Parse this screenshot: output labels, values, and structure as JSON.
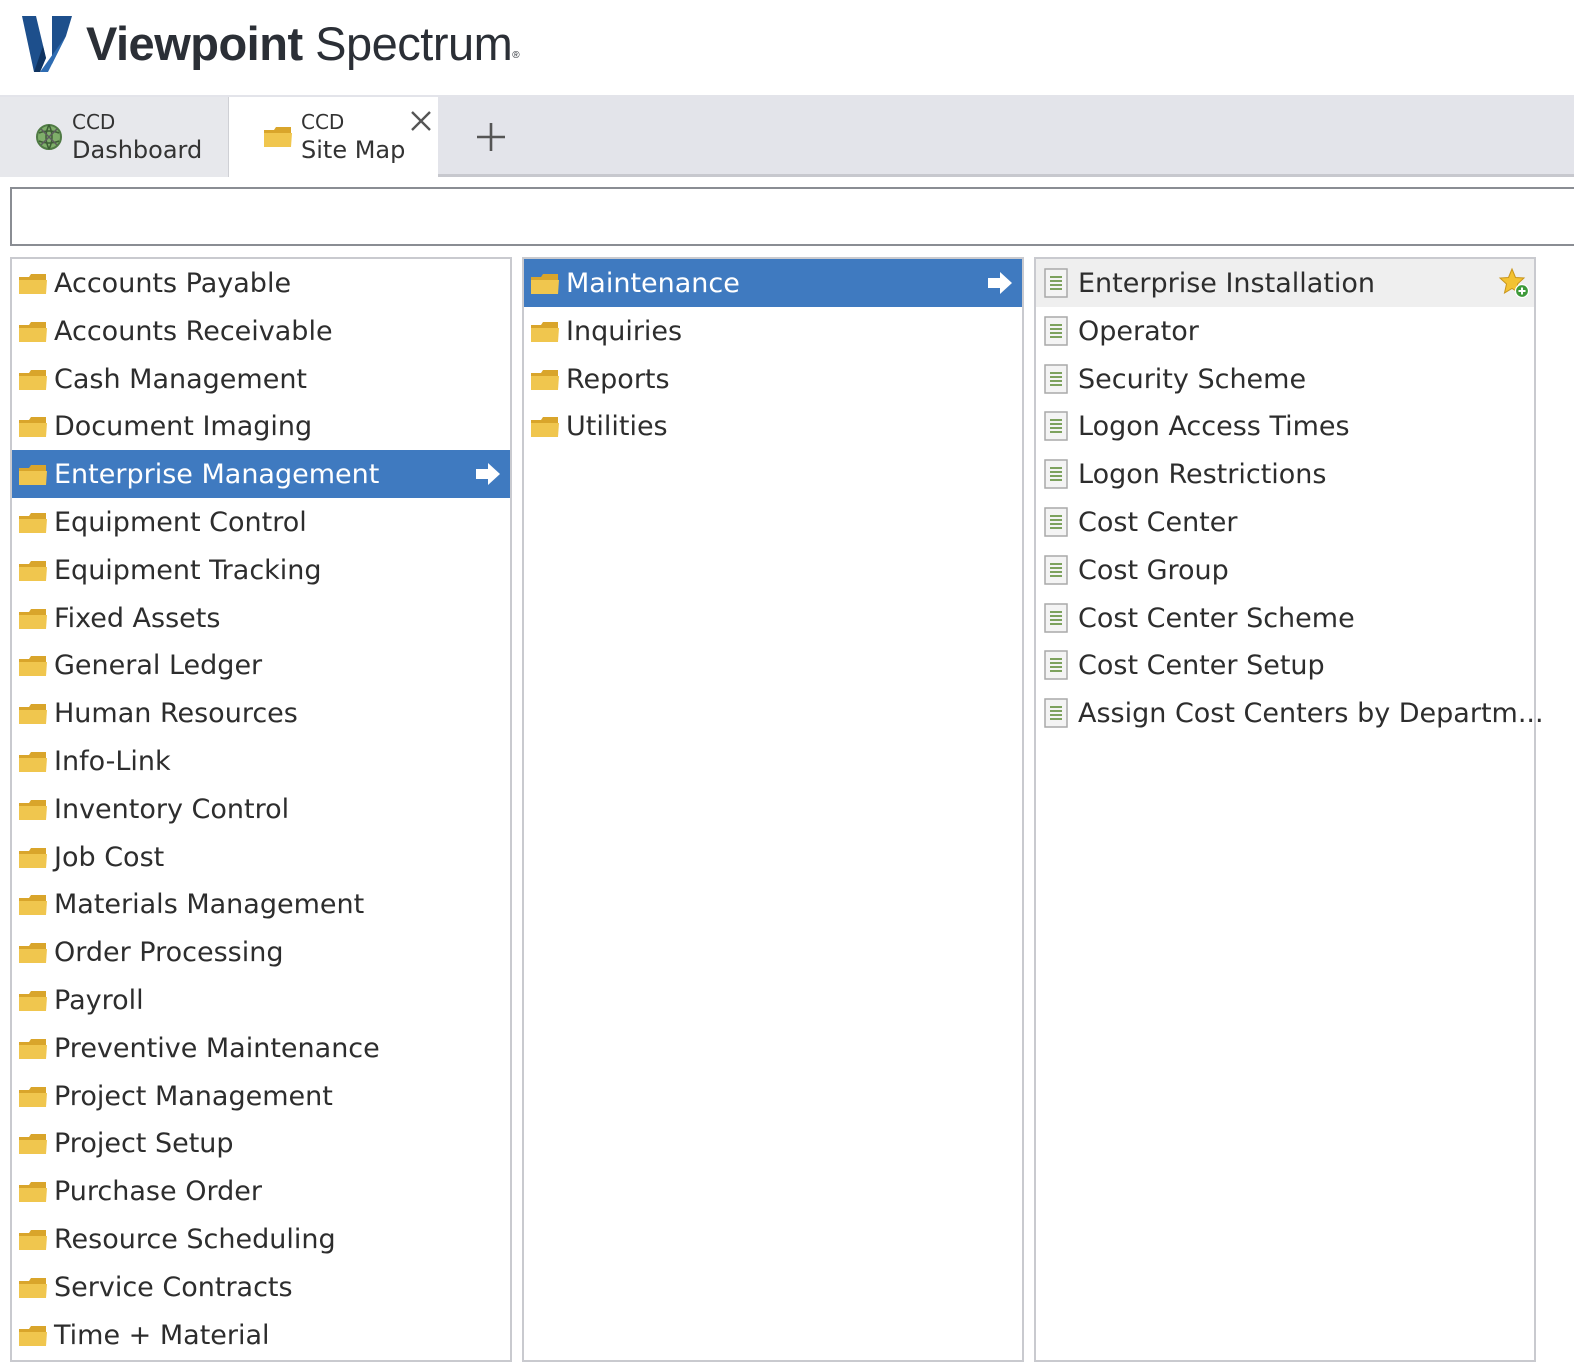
{
  "app": {
    "brand_bold": "Viewpoint",
    "brand_light": "Spectrum",
    "brand_mark": "®"
  },
  "tabs": [
    {
      "line1": "CCD",
      "line2": "Dashboard",
      "icon": "globe-icon",
      "active": false
    },
    {
      "line1": "CCD",
      "line2": "Site Map",
      "icon": "folder-icon",
      "active": true
    }
  ],
  "search": {
    "value": "",
    "placeholder": ""
  },
  "modules": [
    "Accounts Payable",
    "Accounts Receivable",
    "Cash Management",
    "Document Imaging",
    "Enterprise Management",
    "Equipment Control",
    "Equipment Tracking",
    "Fixed Assets",
    "General Ledger",
    "Human Resources",
    "Info-Link",
    "Inventory Control",
    "Job Cost",
    "Materials Management",
    "Order Processing",
    "Payroll",
    "Preventive Maintenance",
    "Project Management",
    "Project Setup",
    "Purchase Order",
    "Resource Scheduling",
    "Service Contracts",
    "Time + Material"
  ],
  "selected_module": "Enterprise Management",
  "categories": [
    "Maintenance",
    "Inquiries",
    "Reports",
    "Utilities"
  ],
  "selected_category": "Maintenance",
  "screens": [
    "Enterprise Installation",
    "Operator",
    "Security Scheme",
    "Logon Access Times",
    "Logon Restrictions",
    "Cost Center",
    "Cost Group",
    "Cost Center Scheme",
    "Cost Center Setup",
    "Assign Cost Centers by Departm..."
  ],
  "hovered_screen": "Enterprise Installation",
  "colors": {
    "selection": "#3f7ac0",
    "folder": "#e8b93f",
    "tabbar": "#e3e4ea",
    "logo": "#1d4f8c"
  }
}
